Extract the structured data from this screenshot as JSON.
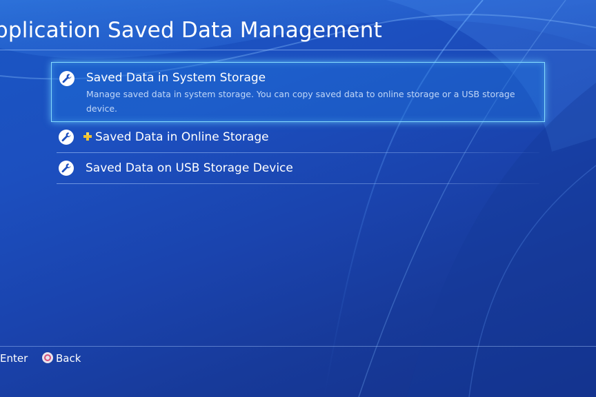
{
  "page": {
    "title": "pplication Saved Data Management"
  },
  "menu": {
    "items": [
      {
        "icon": "wrench-icon",
        "label": "Saved Data in System Storage",
        "description": "Manage saved data in system storage. You can copy saved data to online storage or a USB storage device.",
        "focused": true
      },
      {
        "icon": "wrench-icon",
        "badge_icon": "ps-plus-icon",
        "label": "Saved Data in Online Storage",
        "focused": false
      },
      {
        "icon": "wrench-icon",
        "label": "Saved Data on USB Storage Device",
        "focused": false
      }
    ]
  },
  "footer": {
    "enter_label": "Enter",
    "back_label": "Back",
    "back_button_icon": "circle-button-icon"
  },
  "colors": {
    "background": "#1c4fbf",
    "focus_border": "#8ce1ff",
    "ps_plus": "#f2c230",
    "circle_button": "#d34f7a"
  }
}
